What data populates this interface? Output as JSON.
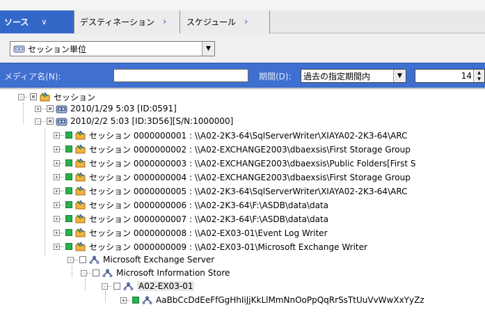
{
  "tabs": {
    "source": "ソース",
    "destination": "デスティネーション",
    "schedule": "スケジュール"
  },
  "view": {
    "selected": "セッション単位"
  },
  "filter": {
    "media_label": "メディア名(N):",
    "media_value": "",
    "period_label": "期間(D):",
    "period_selected": "過去の指定期間内",
    "days_value": "14"
  },
  "tree": {
    "root": "セッション",
    "session1": "2010/1/29 5:03 [ID:0591]",
    "session2": "2010/2/2 5:03 [ID:3D56][S/N:1000000]",
    "items": [
      "セッション 0000000001 : \\\\A02-2K3-64\\SqlServerWriter\\XIAYA02-2K3-64\\ARC",
      "セッション 0000000002 : \\\\A02-EXCHANGE2003\\dbaexsis\\First Storage Group",
      "セッション 0000000003 : \\\\A02-EXCHANGE2003\\dbaexsis\\Public Folders[First S",
      "セッション 0000000004 : \\\\A02-EXCHANGE2003\\dbaexsis\\First Storage Group",
      "セッション 0000000005 : \\\\A02-2K3-64\\SqlServerWriter\\XIAYA02-2K3-64\\ARC",
      "セッション 0000000006 : \\\\A02-2K3-64\\F:\\ASDB\\data\\data",
      "セッション 0000000007 : \\\\A02-2K3-64\\F:\\ASDB\\data\\data",
      "セッション 0000000008 : \\\\A02-EX03-01\\Event Log Writer",
      "セッション 0000000009 : \\\\A02-EX03-01\\Microsoft Exchange Writer"
    ],
    "exchange_server": "Microsoft Exchange Server",
    "info_store": "Microsoft Information Store",
    "server_node": "A02-EX03-01",
    "mailbox": "AaBbCcDdEeFfGgHhIiJjKkLlMmNnOoPpQqRrSsTtUuVvWwXxYyZz"
  }
}
